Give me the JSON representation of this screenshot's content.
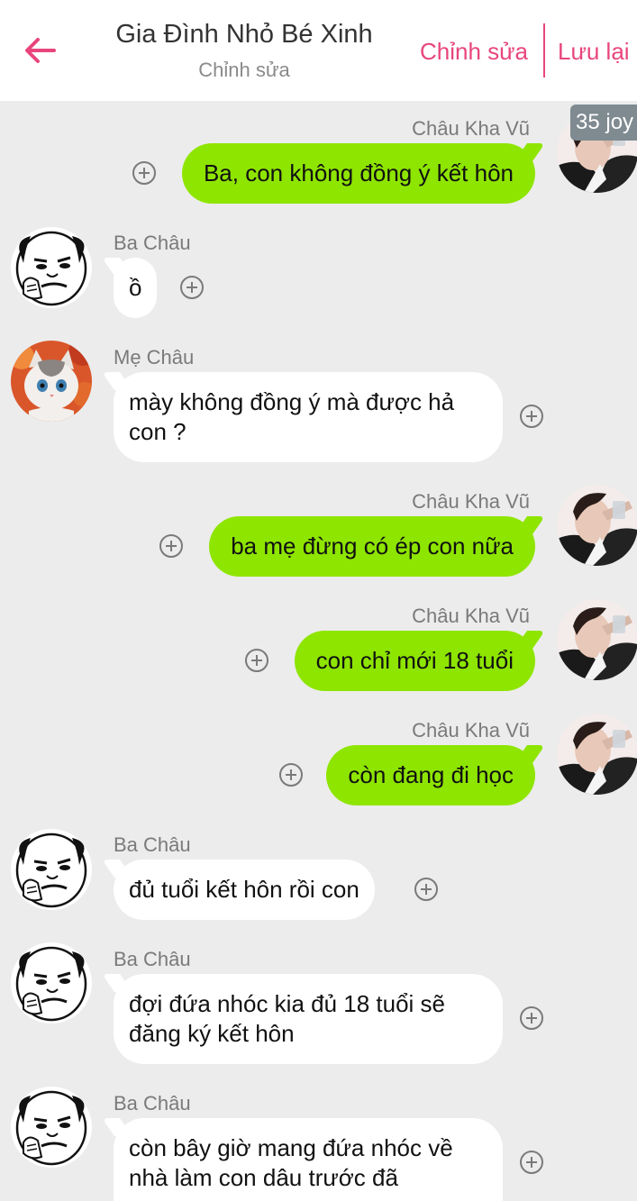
{
  "header": {
    "title": "Gia Đình Nhỏ Bé Xinh",
    "subtitle": "Chỉnh sửa",
    "edit_label": "Chỉnh sửa",
    "save_label": "Lưu lại",
    "accent_color": "#e8467c"
  },
  "badge": "35 joy",
  "colors": {
    "my_bubble": "#8ee500",
    "other_bubble": "#ffffff",
    "background": "#ececec"
  },
  "messages": [
    {
      "sender": "Châu Kha Vũ",
      "text": "Ba, con không đồng ý kết hôn",
      "side": "right",
      "avatar": "boy-avatar"
    },
    {
      "sender": "Ba Châu",
      "text": "ồ",
      "side": "left",
      "avatar": "meme-face-avatar"
    },
    {
      "sender": "Mẹ Châu",
      "lines": [
        "mày không đồng ý mà được hả",
        "con ?"
      ],
      "side": "left",
      "avatar": "cat-avatar"
    },
    {
      "sender": "Châu Kha Vũ",
      "text": "ba mẹ đừng có ép con nữa",
      "side": "right",
      "avatar": "boy-avatar"
    },
    {
      "sender": "Châu Kha Vũ",
      "text": "con chỉ mới 18 tuổi",
      "side": "right",
      "avatar": "boy-avatar"
    },
    {
      "sender": "Châu Kha Vũ",
      "text": "còn đang đi học",
      "side": "right",
      "avatar": "boy-avatar"
    },
    {
      "sender": "Ba Châu",
      "text": "đủ tuổi kết hôn rồi con",
      "side": "left",
      "avatar": "meme-face-avatar"
    },
    {
      "sender": "Ba Châu",
      "lines": [
        "đợi đứa nhóc kia đủ 18 tuổi sẽ",
        "đăng ký kết hôn"
      ],
      "side": "left",
      "avatar": "meme-face-avatar"
    },
    {
      "sender": "Ba Châu",
      "lines": [
        "còn bây giờ mang đứa nhóc về",
        "nhà làm con dâu trước đã"
      ],
      "side": "left",
      "avatar": "meme-face-avatar"
    }
  ]
}
